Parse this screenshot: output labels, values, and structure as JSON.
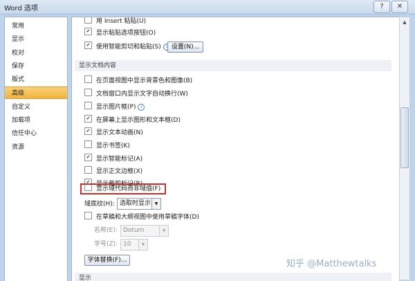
{
  "window": {
    "title": "Word 选项",
    "help_label": "?",
    "close_label": "✕"
  },
  "sidebar": {
    "items": [
      {
        "label": "常用"
      },
      {
        "label": "显示"
      },
      {
        "label": "校对"
      },
      {
        "label": "保存"
      },
      {
        "label": "版式"
      },
      {
        "label": "高级",
        "active": true
      },
      {
        "label": "自定义"
      },
      {
        "label": "加载项"
      },
      {
        "label": "信任中心"
      },
      {
        "label": "资源"
      }
    ]
  },
  "cut_paste": {
    "use_insert": "用 Insert 粘贴(U)",
    "show_paste_options": "显示粘贴选项按钮(O)",
    "smart_cut_paste": "使用智能剪切和粘贴(S)",
    "settings_button": "设置(N)..."
  },
  "doc_content": {
    "header": "显示文档内容",
    "options": [
      {
        "label": "在页面视图中显示背景色和图像(B)",
        "checked": false
      },
      {
        "label": "文档窗口内显示文字自动换行(W)",
        "checked": false
      },
      {
        "label": "显示图片框(P)",
        "checked": false,
        "info": true
      },
      {
        "label": "在屏幕上显示图形和文本框(D)",
        "checked": true
      },
      {
        "label": "显示文本动画(N)",
        "checked": true
      },
      {
        "label": "显示书签(K)",
        "checked": false
      },
      {
        "label": "显示智能标记(A)",
        "checked": true
      },
      {
        "label": "显示正文边框(X)",
        "checked": false
      },
      {
        "label": "显示裁剪标记(R)",
        "checked": true
      },
      {
        "label": "显示域代码而非域值(F)",
        "checked": false
      }
    ],
    "field_shading_label": "域底纹(H):",
    "field_shading_value": "选取时显示",
    "draft_font_option": "在草稿和大纲视图中使用草稿字体(D)",
    "name_label": "名称(E):",
    "name_value": "Dotum",
    "size_label": "字号(Z):",
    "size_value": "10",
    "font_sub_button": "字体替换(F)..."
  },
  "next_section_header": "显示",
  "watermark": "知乎 @Matthewtalks",
  "icons": {
    "info": "info-icon",
    "dropdown": "chevron-down-icon",
    "scroll_up": "scroll-up-icon",
    "scroll_down": "scroll-down-icon"
  }
}
